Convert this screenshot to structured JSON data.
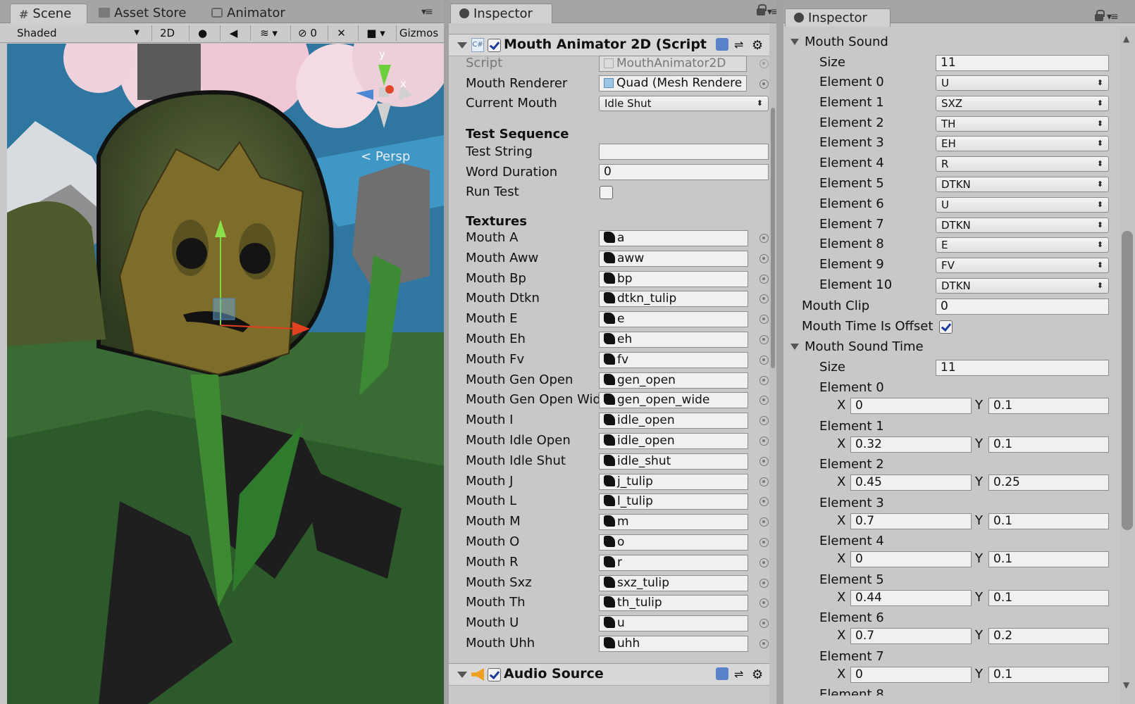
{
  "scene_panel": {
    "tabs": [
      {
        "label": "Scene",
        "icon": "hash-icon"
      },
      {
        "label": "Asset Store",
        "icon": "store-icon"
      },
      {
        "label": "Animator",
        "icon": "animator-icon"
      }
    ],
    "toolbar": {
      "shading_mode": "Shaded",
      "mode_2d": "2D",
      "hidden_count": "0",
      "gizmos": "Gizmos"
    },
    "viewport": {
      "projection_label": "Persp"
    }
  },
  "inspector_middle": {
    "tab": "Inspector",
    "component": {
      "title": "Mouth Animator 2D (Script",
      "enabled": true,
      "fields": {
        "script_label": "Script",
        "script_value": "MouthAnimator2D",
        "mouth_renderer_label": "Mouth Renderer",
        "mouth_renderer_value": "Quad (Mesh Rendere",
        "current_mouth_label": "Current Mouth",
        "current_mouth_value": "Idle Shut"
      },
      "test_sequence": {
        "header": "Test Sequence",
        "test_string_label": "Test String",
        "test_string_value": "",
        "word_duration_label": "Word Duration",
        "word_duration_value": "0",
        "run_test_label": "Run Test",
        "run_test_checked": false
      },
      "textures": {
        "header": "Textures",
        "items": [
          {
            "label": "Mouth A",
            "value": "a"
          },
          {
            "label": "Mouth Aww",
            "value": "aww"
          },
          {
            "label": "Mouth Bp",
            "value": "bp"
          },
          {
            "label": "Mouth Dtkn",
            "value": "dtkn_tulip"
          },
          {
            "label": "Mouth E",
            "value": "e"
          },
          {
            "label": "Mouth Eh",
            "value": "eh"
          },
          {
            "label": "Mouth Fv",
            "value": "fv"
          },
          {
            "label": "Mouth Gen Open",
            "value": "gen_open"
          },
          {
            "label": "Mouth Gen Open Wid",
            "value": "gen_open_wide"
          },
          {
            "label": "Mouth I",
            "value": "idle_open"
          },
          {
            "label": "Mouth Idle Open",
            "value": "idle_open"
          },
          {
            "label": "Mouth Idle Shut",
            "value": "idle_shut"
          },
          {
            "label": "Mouth J",
            "value": "j_tulip"
          },
          {
            "label": "Mouth L",
            "value": "l_tulip"
          },
          {
            "label": "Mouth M",
            "value": "m"
          },
          {
            "label": "Mouth O",
            "value": "o"
          },
          {
            "label": "Mouth R",
            "value": "r"
          },
          {
            "label": "Mouth Sxz",
            "value": "sxz_tulip"
          },
          {
            "label": "Mouth Th",
            "value": "th_tulip"
          },
          {
            "label": "Mouth U",
            "value": "u"
          },
          {
            "label": "Mouth Uhh",
            "value": "uhh"
          }
        ]
      }
    },
    "audio_source": {
      "title": "Audio Source",
      "enabled": true
    }
  },
  "inspector_right": {
    "tab": "Inspector",
    "mouth_sound": {
      "header": "Mouth Sound",
      "size_label": "Size",
      "size_value": "11",
      "elements": [
        {
          "label": "Element 0",
          "value": "U"
        },
        {
          "label": "Element 1",
          "value": "SXZ"
        },
        {
          "label": "Element 2",
          "value": "TH"
        },
        {
          "label": "Element 3",
          "value": "EH"
        },
        {
          "label": "Element 4",
          "value": "R"
        },
        {
          "label": "Element 5",
          "value": "DTKN"
        },
        {
          "label": "Element 6",
          "value": "U"
        },
        {
          "label": "Element 7",
          "value": "DTKN"
        },
        {
          "label": "Element 8",
          "value": "E"
        },
        {
          "label": "Element 9",
          "value": "FV"
        },
        {
          "label": "Element 10",
          "value": "DTKN"
        }
      ]
    },
    "mouth_clip_label": "Mouth Clip",
    "mouth_clip_value": "0",
    "mouth_time_offset_label": "Mouth Time Is Offset",
    "mouth_time_offset_checked": true,
    "mouth_sound_time": {
      "header": "Mouth Sound Time",
      "size_label": "Size",
      "size_value": "11",
      "x_label": "X",
      "y_label": "Y",
      "elements": [
        {
          "label": "Element 0",
          "x": "0",
          "y": "0.1"
        },
        {
          "label": "Element 1",
          "x": "0.32",
          "y": "0.1"
        },
        {
          "label": "Element 2",
          "x": "0.45",
          "y": "0.25"
        },
        {
          "label": "Element 3",
          "x": "0.7",
          "y": "0.1"
        },
        {
          "label": "Element 4",
          "x": "0",
          "y": "0.1"
        },
        {
          "label": "Element 5",
          "x": "0.44",
          "y": "0.1"
        },
        {
          "label": "Element 6",
          "x": "0.7",
          "y": "0.2"
        },
        {
          "label": "Element 7",
          "x": "0",
          "y": "0.1"
        }
      ],
      "partial_label": "Element 8"
    }
  }
}
